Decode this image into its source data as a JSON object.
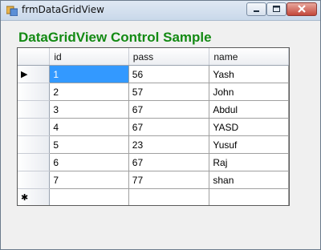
{
  "window": {
    "title": "frmDataGridView"
  },
  "caption": "DataGridView Control Sample",
  "grid": {
    "columns": [
      "id",
      "pass",
      "name"
    ],
    "rows": [
      [
        "1",
        "56",
        "Yash"
      ],
      [
        "2",
        "57",
        "John"
      ],
      [
        "3",
        "67",
        "Abdul"
      ],
      [
        "4",
        "67",
        "YASD"
      ],
      [
        "5",
        "23",
        "Yusuf"
      ],
      [
        "6",
        "67",
        "Raj"
      ],
      [
        "7",
        "77",
        "shan"
      ]
    ],
    "current_row_glyph": "▶",
    "new_row_glyph": "✱",
    "selected_cell": {
      "row": 0,
      "col": 0
    }
  },
  "colors": {
    "caption": "#138a13",
    "selection": "#3399ff"
  }
}
